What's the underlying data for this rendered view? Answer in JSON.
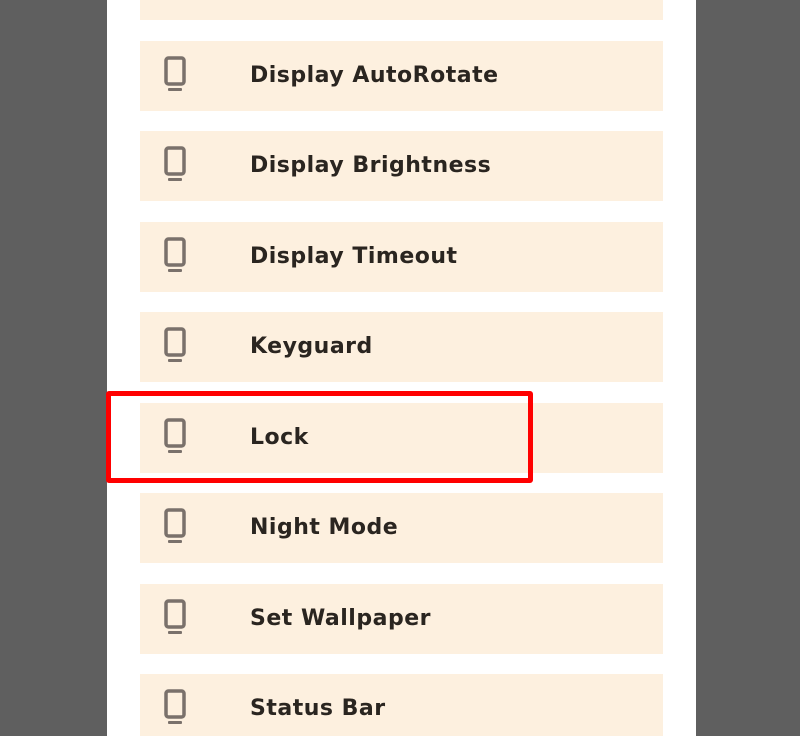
{
  "settings_list": {
    "items": [
      {
        "label": "",
        "icon": "smartphone-icon"
      },
      {
        "label": "Display AutoRotate",
        "icon": "smartphone-icon"
      },
      {
        "label": "Display Brightness",
        "icon": "smartphone-icon"
      },
      {
        "label": "Display Timeout",
        "icon": "smartphone-icon"
      },
      {
        "label": "Keyguard",
        "icon": "smartphone-icon"
      },
      {
        "label": "Lock",
        "icon": "smartphone-icon"
      },
      {
        "label": "Night Mode",
        "icon": "smartphone-icon"
      },
      {
        "label": "Set Wallpaper",
        "icon": "smartphone-icon"
      },
      {
        "label": "Status Bar",
        "icon": "smartphone-icon"
      }
    ]
  },
  "highlighted_item": "Lock",
  "colors": {
    "backdrop": "#5f5f5f",
    "panel": "#ffffff",
    "item_background": "#fdf0df",
    "icon": "#7a716b",
    "text": "#2a2520",
    "highlight": "#ff0000"
  }
}
